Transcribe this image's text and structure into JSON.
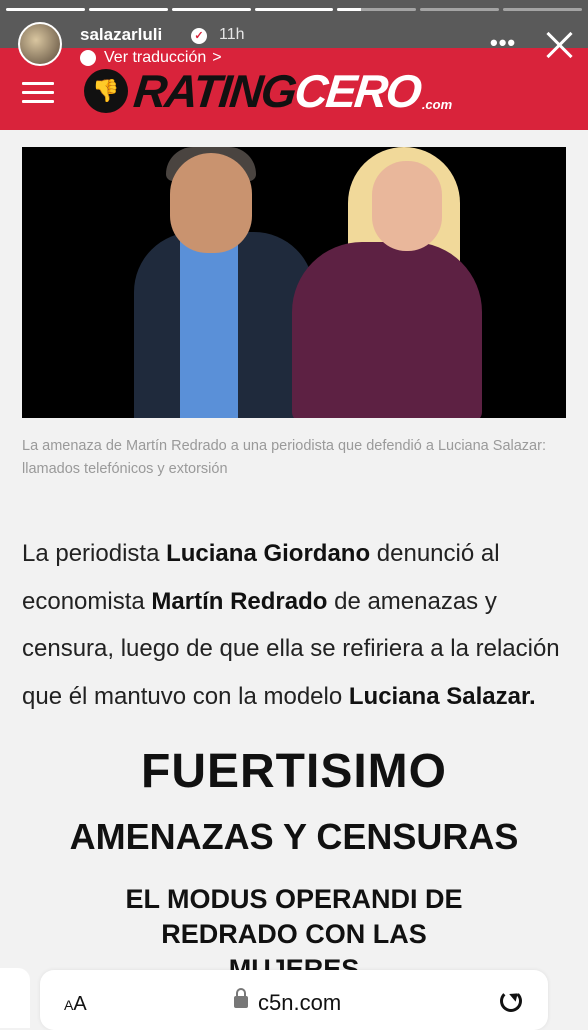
{
  "story": {
    "username": "salazarluli",
    "time": "11h",
    "translate_label": "Ver traducción",
    "translate_arrow": ">",
    "more_label": "•••",
    "verified_icon": "check-icon",
    "progress": [
      1,
      1,
      1,
      1,
      0.3,
      0,
      0
    ]
  },
  "site": {
    "logo_thumb_icon": "thumbs-down-icon",
    "logo_part1": "RATING",
    "logo_part2": "CERO",
    "logo_suffix": ".com",
    "header_color": "#d9233b"
  },
  "article": {
    "caption": "La amenaza de Martín Redrado a una periodista que defendió a Luciana Salazar: llamados telefónicos y extorsión",
    "body": [
      {
        "text": "La periodista ",
        "bold": false
      },
      {
        "text": "Luciana Giordano",
        "bold": true
      },
      {
        "text": " denunció al economista ",
        "bold": false
      },
      {
        "text": "Martín Redrado",
        "bold": true
      },
      {
        "text": " de amenazas y censura, luego de que ella se refiriera a la relación que él mantuvo con la modelo ",
        "bold": false
      },
      {
        "text": "Luciana Salazar.",
        "bold": true
      }
    ]
  },
  "overlay": {
    "title1": "FUERTISIMO",
    "title2": "AMENAZAS Y CENSURAS",
    "title3_line1": "EL MODUS OPERANDI DE",
    "title3_line2": "REDRADO CON LAS",
    "title3_line3": "MUJERES"
  },
  "browser": {
    "text_size_label": "AA",
    "domain": "c5n.com"
  }
}
